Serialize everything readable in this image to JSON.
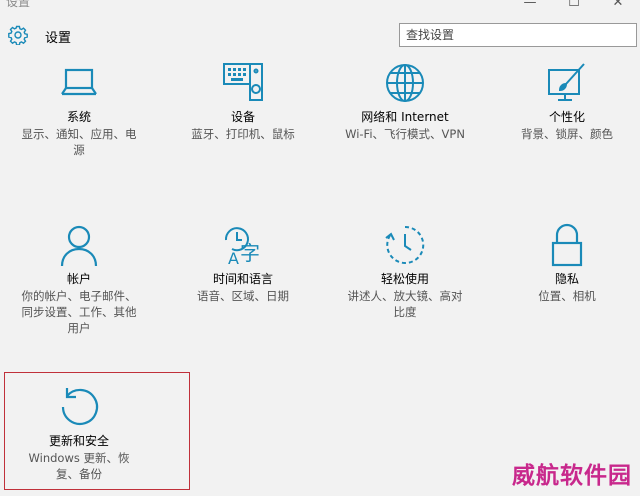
{
  "window": {
    "title": "设置",
    "minimize": "—",
    "maximize": "☐",
    "close": "✕"
  },
  "header": {
    "icon": "gear-icon",
    "title": "设置",
    "search_placeholder": "查找设置"
  },
  "tiles": [
    {
      "icon": "laptop-icon",
      "title": "系统",
      "desc": "显示、通知、应用、电源"
    },
    {
      "icon": "keyboard-speaker-icon",
      "title": "设备",
      "desc": "蓝牙、打印机、鼠标"
    },
    {
      "icon": "globe-icon",
      "title": "网络和 Internet",
      "desc": "Wi-Fi、飞行模式、VPN"
    },
    {
      "icon": "paint-monitor-icon",
      "title": "个性化",
      "desc": "背景、锁屏、颜色"
    },
    {
      "icon": "person-icon",
      "title": "帐户",
      "desc": "你的帐户、电子邮件、同步设置、工作、其他用户"
    },
    {
      "icon": "language-icon",
      "title": "时间和语言",
      "desc": "语音、区域、日期"
    },
    {
      "icon": "ease-of-access-icon",
      "title": "轻松使用",
      "desc": "讲述人、放大镜、高对比度"
    },
    {
      "icon": "lock-icon",
      "title": "隐私",
      "desc": "位置、相机"
    },
    {
      "icon": "update-icon",
      "title": "更新和安全",
      "desc": "Windows 更新、恢复、备份"
    }
  ],
  "accent_color": "#1a8ab8",
  "highlight_color": "#c0303a",
  "watermark": "威航软件园"
}
